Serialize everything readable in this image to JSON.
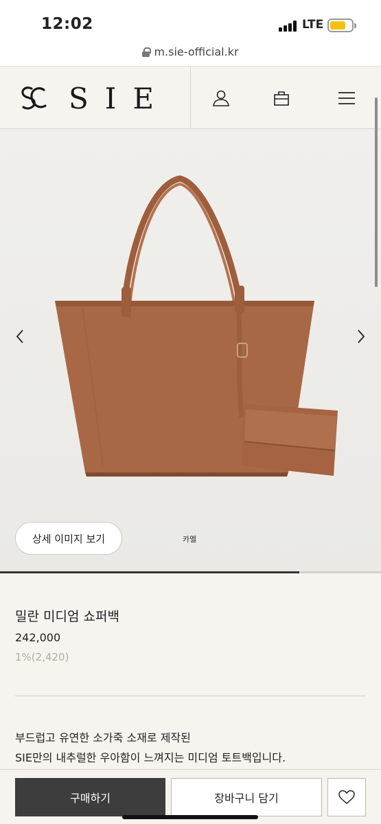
{
  "status": {
    "time": "12:02",
    "network": "LTE",
    "battery_color": "#f3c10e"
  },
  "browser": {
    "url": "m.sie-official.kr"
  },
  "header": {
    "brand": "SIE"
  },
  "gallery": {
    "detail_button": "상세 이미지 보기",
    "color_label": "카멜",
    "bag_color": "#a86845",
    "progress": 0.786
  },
  "product": {
    "name": "밀란 미디엄 쇼퍼백",
    "price": "242,000",
    "point": "1%(2,420)",
    "description": [
      "부드럽고 유연한 소가죽 소재로 제작된",
      "SIE만의 내추럴한 우아함이 느껴지는 미디엄 토트백입니다."
    ]
  },
  "actions": {
    "buy": "구매하기",
    "cart": "장바구니 담기"
  },
  "icons": [
    "lock-icon",
    "user-icon",
    "shopping-bag-icon",
    "menu-icon",
    "chevron-left-icon",
    "chevron-right-icon",
    "heart-icon"
  ]
}
